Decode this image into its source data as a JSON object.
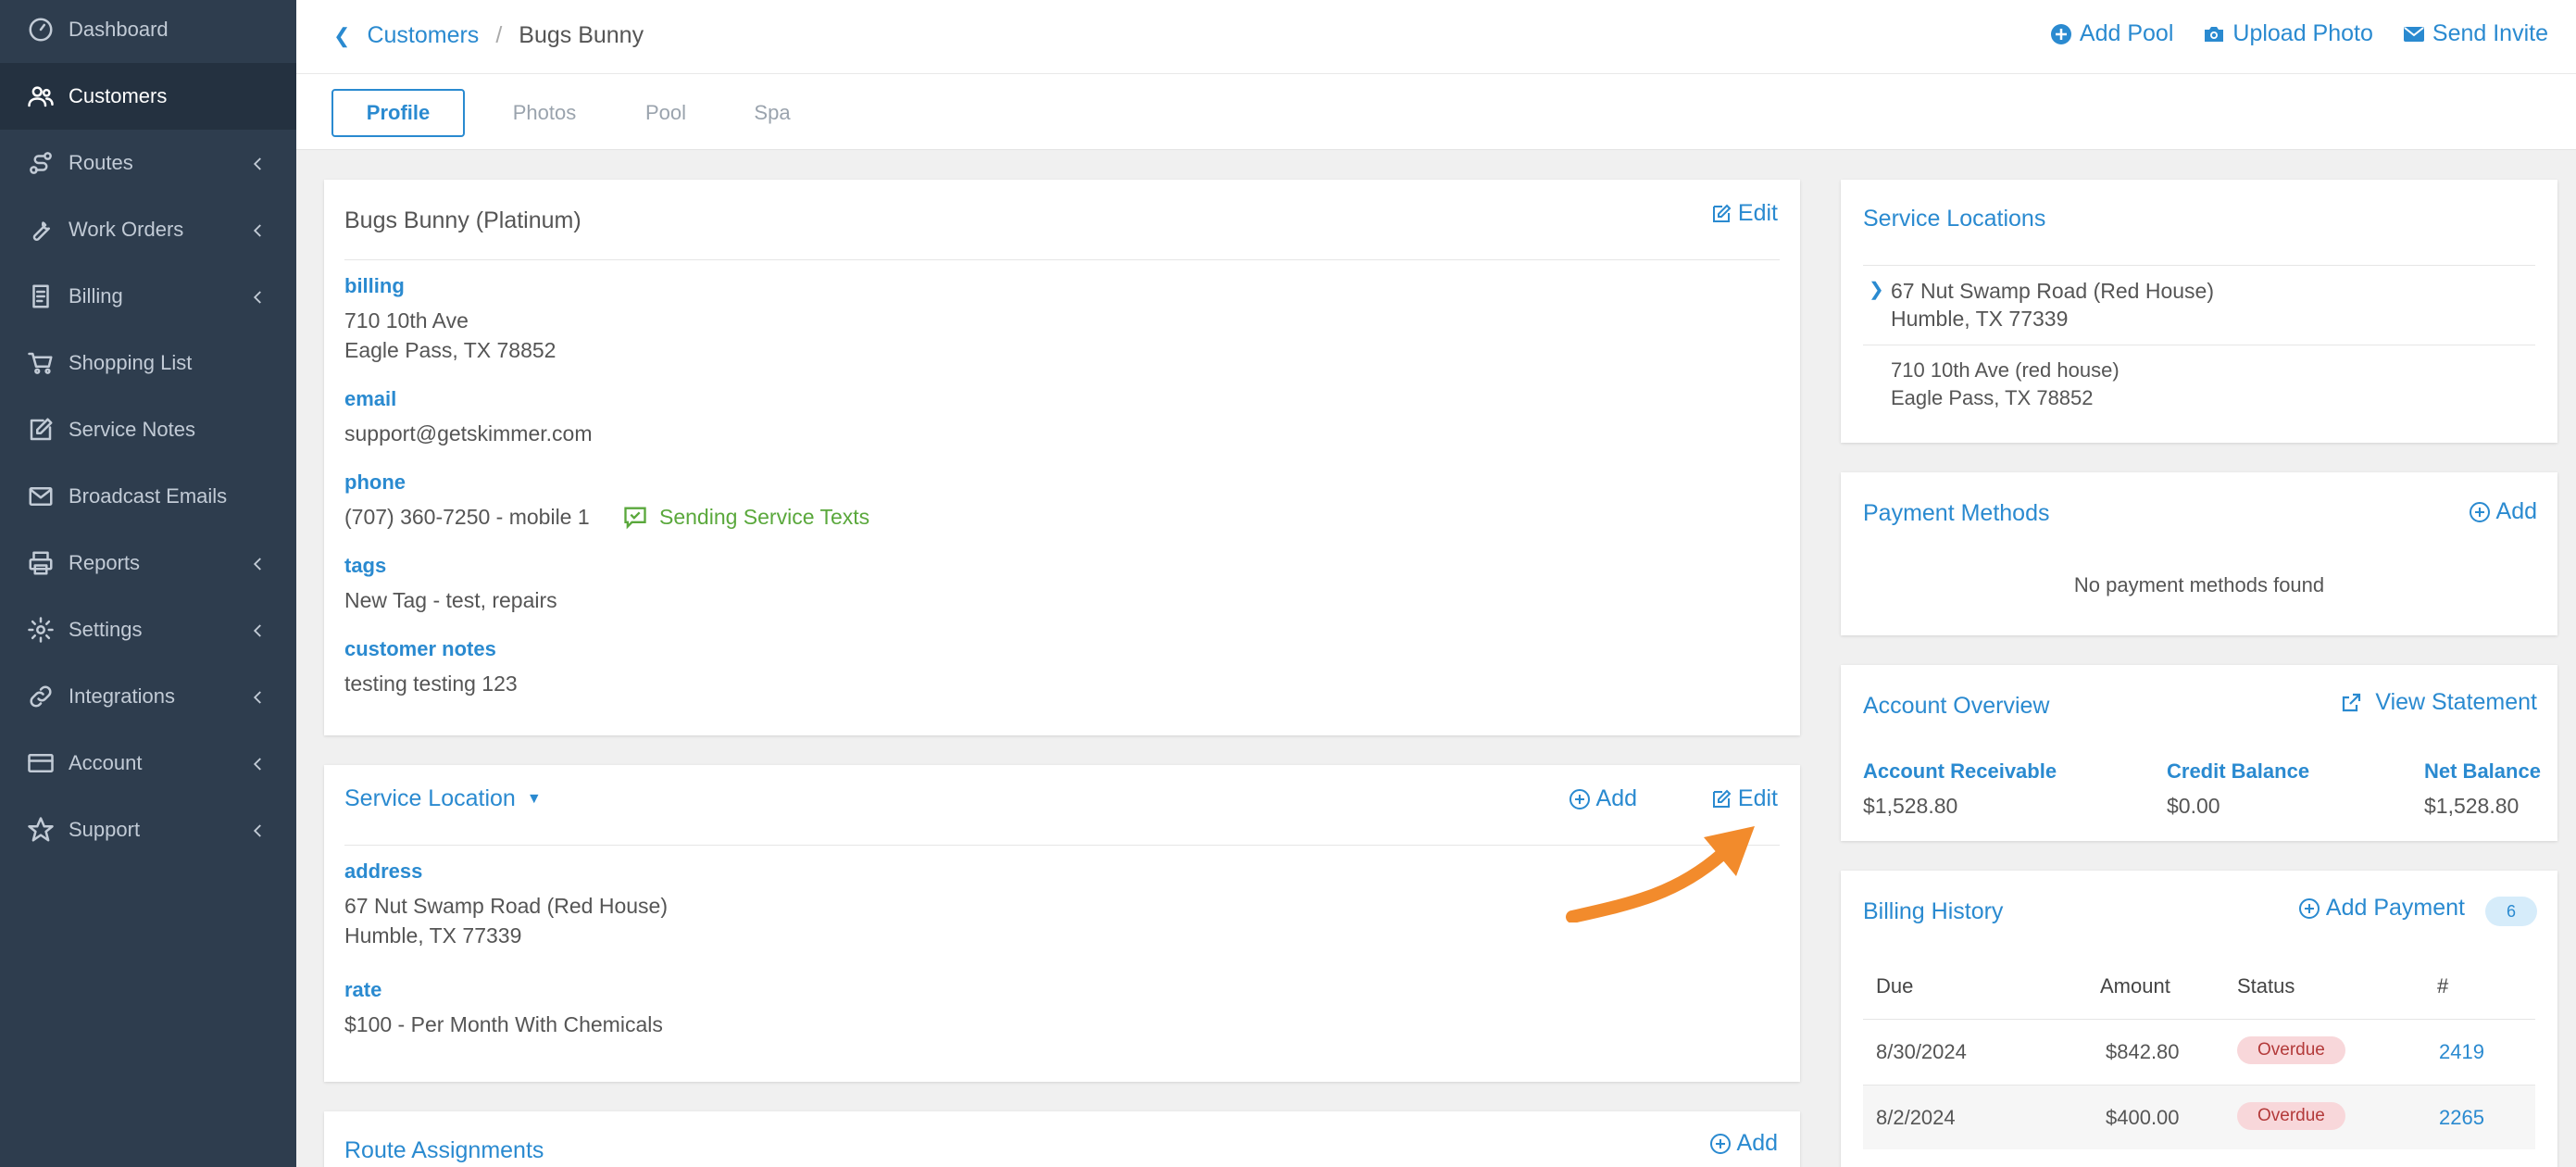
{
  "sidebar": {
    "items": [
      {
        "label": "Dashboard",
        "icon": "dashboard-icon",
        "chevron": false
      },
      {
        "label": "Customers",
        "icon": "users-icon",
        "chevron": false,
        "active": true
      },
      {
        "label": "Routes",
        "icon": "route-icon",
        "chevron": true
      },
      {
        "label": "Work Orders",
        "icon": "wrench-icon",
        "chevron": true
      },
      {
        "label": "Billing",
        "icon": "invoice-icon",
        "chevron": true
      },
      {
        "label": "Shopping List",
        "icon": "cart-icon",
        "chevron": false
      },
      {
        "label": "Service Notes",
        "icon": "edit-icon",
        "chevron": false
      },
      {
        "label": "Broadcast Emails",
        "icon": "envelope-icon",
        "chevron": false
      },
      {
        "label": "Reports",
        "icon": "printer-icon",
        "chevron": true
      },
      {
        "label": "Settings",
        "icon": "gear-icon",
        "chevron": true
      },
      {
        "label": "Integrations",
        "icon": "link-icon",
        "chevron": true
      },
      {
        "label": "Account",
        "icon": "card-icon",
        "chevron": true
      },
      {
        "label": "Support",
        "icon": "star-icon",
        "chevron": true
      }
    ]
  },
  "header": {
    "breadcrumb_parent": "Customers",
    "breadcrumb_sep": "/",
    "breadcrumb_current": "Bugs Bunny",
    "actions": {
      "add_pool": "Add Pool",
      "upload_photo": "Upload Photo",
      "send_invite": "Send Invite"
    }
  },
  "tabs": [
    "Profile",
    "Photos",
    "Pool",
    "Spa"
  ],
  "profile": {
    "name": "Bugs Bunny (Platinum)",
    "edit_label": "Edit",
    "billing_label": "billing",
    "billing_line1": "710 10th Ave",
    "billing_line2": "Eagle Pass, TX 78852",
    "email_label": "email",
    "email": "support@getskimmer.com",
    "phone_label": "phone",
    "phone": "(707) 360-7250 - mobile 1",
    "texts_status": "Sending Service Texts",
    "tags_label": "tags",
    "tags": "New Tag - test, repairs",
    "notes_label": "customer notes",
    "notes": "testing testing 123"
  },
  "service_location": {
    "title": "Service Location",
    "add_label": "Add",
    "edit_label": "Edit",
    "address_label": "address",
    "address_line1": "67 Nut Swamp Road (Red House)",
    "address_line2": "Humble, TX 77339",
    "rate_label": "rate",
    "rate": "$100 - Per Month With Chemicals"
  },
  "route_assignments": {
    "title": "Route Assignments",
    "add_label": "Add"
  },
  "service_locations": {
    "title": "Service Locations",
    "items": [
      {
        "line1": "67 Nut Swamp Road (Red House)",
        "line2": "Humble, TX 77339",
        "selected": true
      },
      {
        "line1": "710 10th Ave (red house)",
        "line2": "Eagle Pass, TX 78852",
        "selected": false
      }
    ]
  },
  "payment_methods": {
    "title": "Payment Methods",
    "add_label": "Add",
    "empty": "No payment methods found"
  },
  "account_overview": {
    "title": "Account Overview",
    "view_statement": "View Statement",
    "receivable_label": "Account Receivable",
    "receivable": "$1,528.80",
    "credit_label": "Credit Balance",
    "credit": "$0.00",
    "net_label": "Net Balance",
    "net": "$1,528.80"
  },
  "billing_history": {
    "title": "Billing History",
    "add_payment": "Add Payment",
    "count": "6",
    "columns": [
      "Due",
      "Amount",
      "Status",
      "#"
    ],
    "rows": [
      {
        "due": "8/30/2024",
        "amount": "$842.80",
        "status": "Overdue",
        "num": "2419"
      },
      {
        "due": "8/2/2024",
        "amount": "$400.00",
        "status": "Overdue",
        "num": "2265"
      }
    ]
  },
  "colors": {
    "sidebar_bg": "#2e3d4e",
    "accent": "#2a8ad0",
    "success": "#5aa83c",
    "overdue_bg": "#f8d7da",
    "arrow": "#f28b2c"
  }
}
